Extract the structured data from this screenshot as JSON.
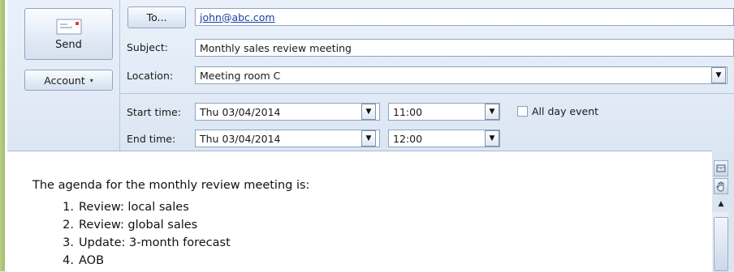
{
  "toolbar": {
    "send_label": "Send",
    "account_label": "Account",
    "account_chevron": "▾"
  },
  "fields": {
    "to_button": "To...",
    "to_value": "john@abc.com",
    "subject_label": "Subject:",
    "subject_value": "Monthly sales review meeting",
    "location_label": "Location:",
    "location_value": "Meeting room C",
    "start_label": "Start time:",
    "start_date": "Thu 03/04/2014",
    "start_time": "11:00",
    "end_label": "End time:",
    "end_date": "Thu 03/04/2014",
    "end_time": "12:00",
    "all_day_label": "All day event",
    "all_day_checked": false
  },
  "body": {
    "intro": "The agenda for the monthly review meeting is:",
    "items": [
      {
        "num": "1.",
        "text": "Review: local sales"
      },
      {
        "num": "2.",
        "text": "Review: global sales"
      },
      {
        "num": "3.",
        "text": "Update: 3-month forecast"
      },
      {
        "num": "4.",
        "text": "AOB"
      }
    ]
  },
  "icons": {
    "dropdown": "▼",
    "scroll_up": "▲"
  }
}
